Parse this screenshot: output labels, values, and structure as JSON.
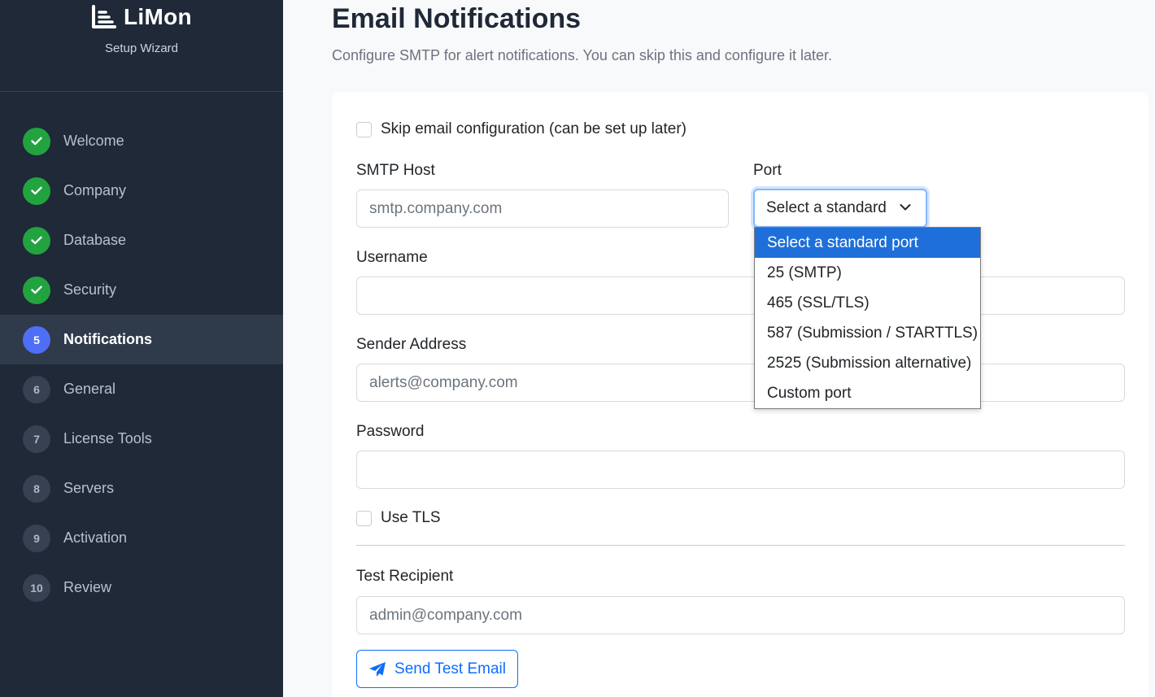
{
  "brand": {
    "name": "LiMon",
    "subtitle": "Setup Wizard"
  },
  "steps": [
    {
      "label": "Welcome",
      "state": "done",
      "badge": ""
    },
    {
      "label": "Company",
      "state": "done",
      "badge": ""
    },
    {
      "label": "Database",
      "state": "done",
      "badge": ""
    },
    {
      "label": "Security",
      "state": "done",
      "badge": ""
    },
    {
      "label": "Notifications",
      "state": "current",
      "badge": "5"
    },
    {
      "label": "General",
      "state": "pending",
      "badge": "6"
    },
    {
      "label": "License Tools",
      "state": "pending",
      "badge": "7"
    },
    {
      "label": "Servers",
      "state": "pending",
      "badge": "8"
    },
    {
      "label": "Activation",
      "state": "pending",
      "badge": "9"
    },
    {
      "label": "Review",
      "state": "pending",
      "badge": "10"
    }
  ],
  "page": {
    "title": "Email Notifications",
    "subtitle": "Configure SMTP for alert notifications. You can skip this and configure it later."
  },
  "form": {
    "skip_label": "Skip email configuration (can be set up later)",
    "smtp_host_label": "SMTP Host",
    "smtp_host_placeholder": "smtp.company.com",
    "port_label": "Port",
    "port_selected": "Select a standard",
    "port_options": [
      "Select a standard port",
      "25 (SMTP)",
      "465 (SSL/TLS)",
      "587 (Submission / STARTTLS)",
      "2525 (Submission alternative)",
      "Custom port"
    ],
    "username_label": "Username",
    "username_value": "",
    "sender_label": "Sender Address",
    "sender_placeholder": "alerts@company.com",
    "password_label": "Password",
    "password_value": "",
    "tls_label": "Use TLS",
    "test_recipient_label": "Test Recipient",
    "test_recipient_placeholder": "admin@company.com",
    "send_test_label": "Send Test Email"
  },
  "colors": {
    "sidebar_bg": "#1f2937",
    "done_green": "#22a33f",
    "current_blue": "#4f6ef7",
    "primary": "#0d6efd",
    "option_highlight": "#1e6fd9"
  },
  "icons": {
    "brand": "chart-bars-icon",
    "done": "check-icon",
    "select": "chevron-down-icon",
    "send": "paper-plane-icon"
  }
}
